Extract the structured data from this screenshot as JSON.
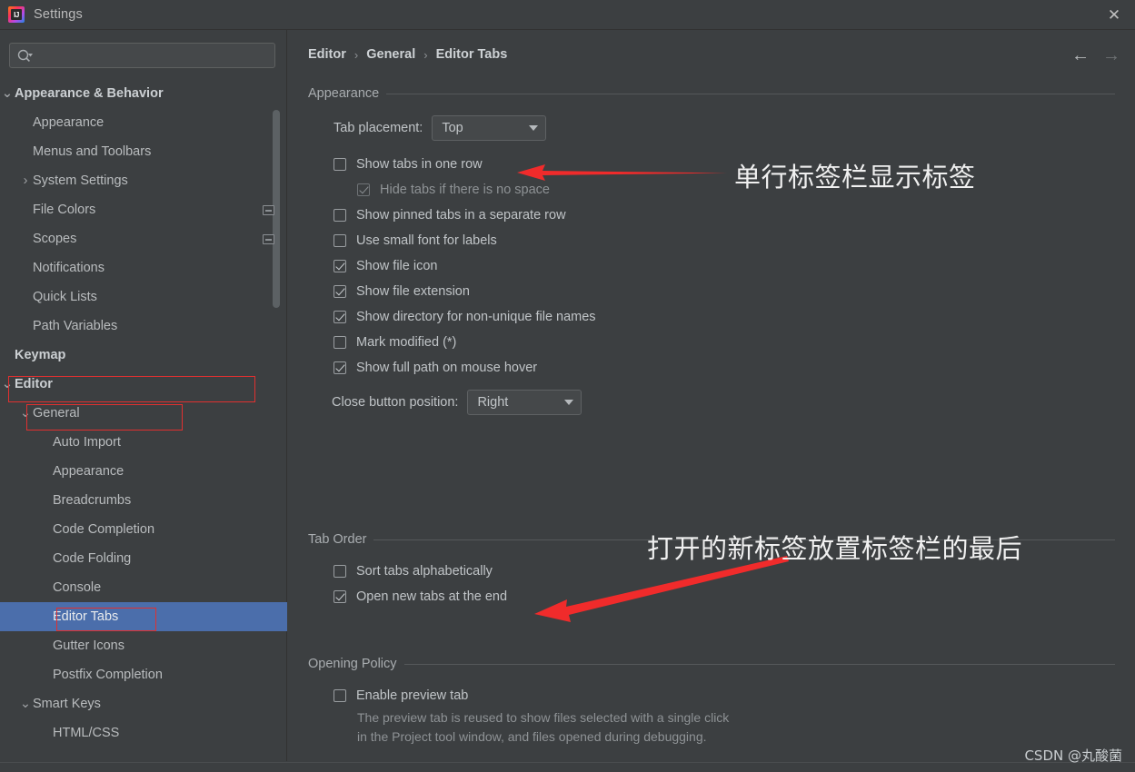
{
  "window": {
    "title": "Settings",
    "close_label": "✕",
    "logo_text": "IJ"
  },
  "sidebar": {
    "search": {
      "placeholder": "",
      "value": "",
      "icon": "search-icon"
    },
    "items": [
      {
        "label": "Appearance & Behavior",
        "indent": 0,
        "twisty": "⌄",
        "bold": true,
        "selected": false,
        "badge": false
      },
      {
        "label": "Appearance",
        "indent": 1,
        "twisty": "",
        "bold": false,
        "selected": false,
        "badge": false
      },
      {
        "label": "Menus and Toolbars",
        "indent": 1,
        "twisty": "",
        "bold": false,
        "selected": false,
        "badge": false
      },
      {
        "label": "System Settings",
        "indent": 1,
        "twisty": "›",
        "bold": false,
        "selected": false,
        "badge": false
      },
      {
        "label": "File Colors",
        "indent": 1,
        "twisty": "",
        "bold": false,
        "selected": false,
        "badge": true
      },
      {
        "label": "Scopes",
        "indent": 1,
        "twisty": "",
        "bold": false,
        "selected": false,
        "badge": true
      },
      {
        "label": "Notifications",
        "indent": 1,
        "twisty": "",
        "bold": false,
        "selected": false,
        "badge": false
      },
      {
        "label": "Quick Lists",
        "indent": 1,
        "twisty": "",
        "bold": false,
        "selected": false,
        "badge": false
      },
      {
        "label": "Path Variables",
        "indent": 1,
        "twisty": "",
        "bold": false,
        "selected": false,
        "badge": false
      },
      {
        "label": "Keymap",
        "indent": 0,
        "twisty": "",
        "bold": true,
        "selected": false,
        "badge": false
      },
      {
        "label": "Editor",
        "indent": 0,
        "twisty": "⌄",
        "bold": true,
        "selected": false,
        "badge": false
      },
      {
        "label": "General",
        "indent": 1,
        "twisty": "⌄",
        "bold": false,
        "selected": false,
        "badge": false
      },
      {
        "label": "Auto Import",
        "indent": 2,
        "twisty": "",
        "bold": false,
        "selected": false,
        "badge": false
      },
      {
        "label": "Appearance",
        "indent": 2,
        "twisty": "",
        "bold": false,
        "selected": false,
        "badge": false
      },
      {
        "label": "Breadcrumbs",
        "indent": 2,
        "twisty": "",
        "bold": false,
        "selected": false,
        "badge": false
      },
      {
        "label": "Code Completion",
        "indent": 2,
        "twisty": "",
        "bold": false,
        "selected": false,
        "badge": false
      },
      {
        "label": "Code Folding",
        "indent": 2,
        "twisty": "",
        "bold": false,
        "selected": false,
        "badge": false
      },
      {
        "label": "Console",
        "indent": 2,
        "twisty": "",
        "bold": false,
        "selected": false,
        "badge": false
      },
      {
        "label": "Editor Tabs",
        "indent": 2,
        "twisty": "",
        "bold": false,
        "selected": true,
        "badge": false
      },
      {
        "label": "Gutter Icons",
        "indent": 2,
        "twisty": "",
        "bold": false,
        "selected": false,
        "badge": false
      },
      {
        "label": "Postfix Completion",
        "indent": 2,
        "twisty": "",
        "bold": false,
        "selected": false,
        "badge": false
      },
      {
        "label": "Smart Keys",
        "indent": 1,
        "twisty": "⌄",
        "bold": false,
        "selected": false,
        "badge": false
      },
      {
        "label": "HTML/CSS",
        "indent": 2,
        "twisty": "",
        "bold": false,
        "selected": false,
        "badge": false
      }
    ]
  },
  "main": {
    "breadcrumb": [
      "Editor",
      "General",
      "Editor Tabs"
    ],
    "breadcrumb_separator": "›",
    "nav": {
      "back": "←",
      "forward": "→"
    },
    "sections": {
      "appearance": {
        "title": "Appearance",
        "tab_placement_label": "Tab placement:",
        "tab_placement_value": "Top",
        "close_button_label": "Close button position:",
        "close_button_value": "Right",
        "checkboxes": [
          {
            "label": "Show tabs in one row",
            "checked": false,
            "disabled": false,
            "indent": 1
          },
          {
            "label": "Hide tabs if there is no space",
            "checked": true,
            "disabled": true,
            "indent": 2
          },
          {
            "label": "Show pinned tabs in a separate row",
            "checked": false,
            "disabled": false,
            "indent": 1
          },
          {
            "label": "Use small font for labels",
            "checked": false,
            "disabled": false,
            "indent": 1
          },
          {
            "label": "Show file icon",
            "checked": true,
            "disabled": false,
            "indent": 1
          },
          {
            "label": "Show file extension",
            "checked": true,
            "disabled": false,
            "indent": 1
          },
          {
            "label": "Show directory for non-unique file names",
            "checked": true,
            "disabled": false,
            "indent": 1
          },
          {
            "label": "Mark modified (*)",
            "checked": false,
            "disabled": false,
            "indent": 1
          },
          {
            "label": "Show full path on mouse hover",
            "checked": true,
            "disabled": false,
            "indent": 1
          }
        ]
      },
      "tab_order": {
        "title": "Tab Order",
        "checkboxes": [
          {
            "label": "Sort tabs alphabetically",
            "checked": false,
            "disabled": false,
            "indent": 1
          },
          {
            "label": "Open new tabs at the end",
            "checked": true,
            "disabled": false,
            "indent": 1
          }
        ]
      },
      "opening_policy": {
        "title": "Opening Policy",
        "checkboxes": [
          {
            "label": "Enable preview tab",
            "checked": false,
            "disabled": false,
            "indent": 1
          }
        ],
        "hint_line1": "The preview tab is reused to show files selected with a single click",
        "hint_line2": "in the Project tool window, and files opened during debugging."
      }
    }
  },
  "annotations": {
    "color": "#F02B2B",
    "note1": "单行标签栏显示标签",
    "note2": "打开的新标签放置标签栏的最后"
  },
  "watermark": "CSDN @丸酸菌"
}
